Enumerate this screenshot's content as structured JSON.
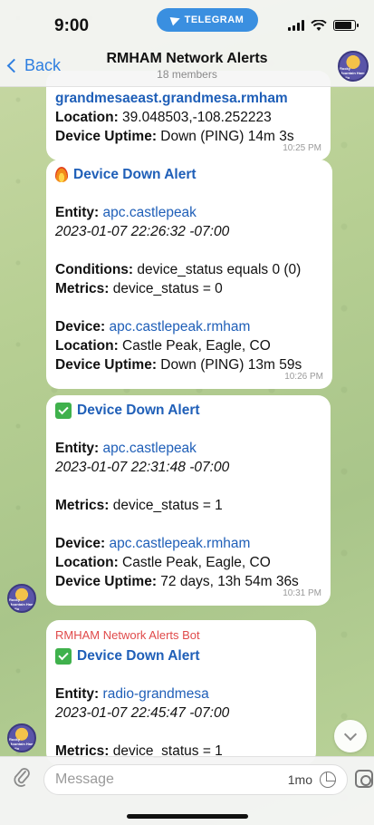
{
  "status_bar": {
    "time": "9:00",
    "app_pill": "TELEGRAM"
  },
  "header": {
    "back_label": "Back",
    "title": "RMHAM Network Alerts",
    "subtitle": "18 members"
  },
  "avatar_text": "Rocky Mountain Ham Radio",
  "messages": [
    {
      "lines": {
        "device": "grandmesaeast.grandmesa.rmham",
        "location_label": "Location:",
        "location": " 39.048503,-108.252223",
        "uptime_label": "Device Uptime:",
        "uptime": " Down (PING) 14m 3s"
      },
      "time": "10:25 PM"
    },
    {
      "title": "Device Down Alert",
      "entity_label": "Entity:",
      "entity": "apc.castlepeak",
      "timestamp": "2023-01-07 22:26:32 -07:00",
      "conditions_label": "Conditions:",
      "conditions": " device_status equals 0 (0)",
      "metrics_label": "Metrics:",
      "metrics": " device_status = 0",
      "device_label": "Device:",
      "device": "apc.castlepeak.rmham",
      "location_label": "Location:",
      "location": " Castle Peak, Eagle, CO",
      "uptime_label": "Device Uptime:",
      "uptime": " Down (PING) 13m 59s",
      "time": "10:26 PM"
    },
    {
      "title": "Device Down Alert",
      "entity_label": "Entity:",
      "entity": "apc.castlepeak",
      "timestamp": "2023-01-07 22:31:48 -07:00",
      "metrics_label": "Metrics:",
      "metrics": " device_status = 1",
      "device_label": "Device:",
      "device": "apc.castlepeak.rmham",
      "location_label": "Location:",
      "location": " Castle Peak, Eagle, CO",
      "uptime_label": "Device Uptime:",
      "uptime": " 72 days, 13h 54m 36s",
      "time": "10:31 PM"
    },
    {
      "sender": "RMHAM Network Alerts Bot",
      "title": "Device Down Alert",
      "entity_label": "Entity:",
      "entity": "radio-grandmesa",
      "timestamp": "2023-01-07 22:45:47 -07:00",
      "metrics_label": "Metrics:",
      "metrics": " device_status = 1"
    }
  ],
  "input": {
    "placeholder": "Message",
    "timer": "1mo"
  }
}
